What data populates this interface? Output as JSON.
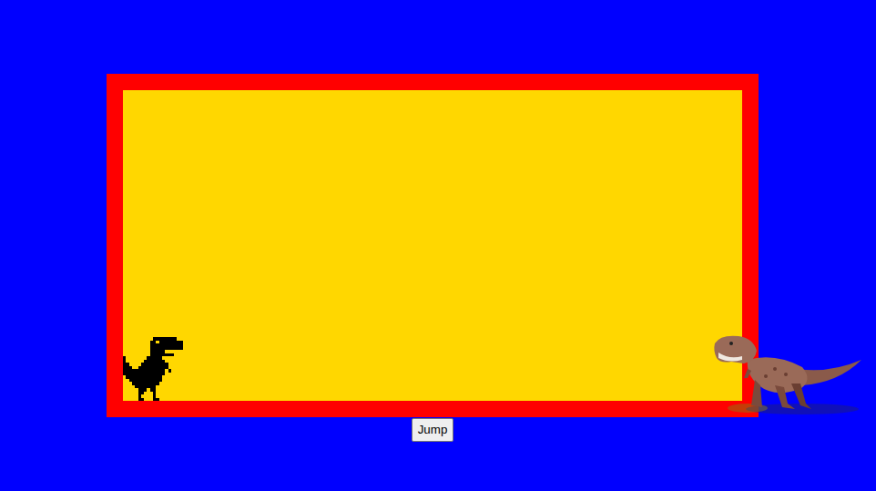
{
  "game": {
    "player": {
      "name": "pixel-dino"
    },
    "enemy": {
      "name": "t-rex"
    }
  },
  "button": {
    "label": "Jump"
  }
}
